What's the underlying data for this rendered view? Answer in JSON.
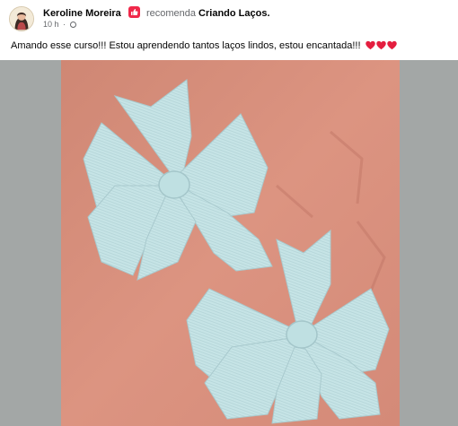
{
  "post": {
    "author": {
      "name": "Keroline Moreira",
      "avatar_icon": "user-avatar"
    },
    "recommendation": {
      "icon": "recommend-icon",
      "icon_color": "#f0284a",
      "verb": "recomenda",
      "page_name": "Criando Laços."
    },
    "meta": {
      "time": "10 h",
      "separator": "·",
      "privacy_icon": "globe-icon"
    },
    "text": "Amando esse curso!!! Estou aprendendo tantos laços lindos, estou encantada!!! ",
    "emoji": [
      "red-heart",
      "red-heart",
      "red-heart"
    ],
    "photo": {
      "subject": "bows-photo",
      "background_color": "#a3a7a6",
      "fabric_color": "#d88f7e",
      "bow_color": "#c6e4e6"
    }
  }
}
